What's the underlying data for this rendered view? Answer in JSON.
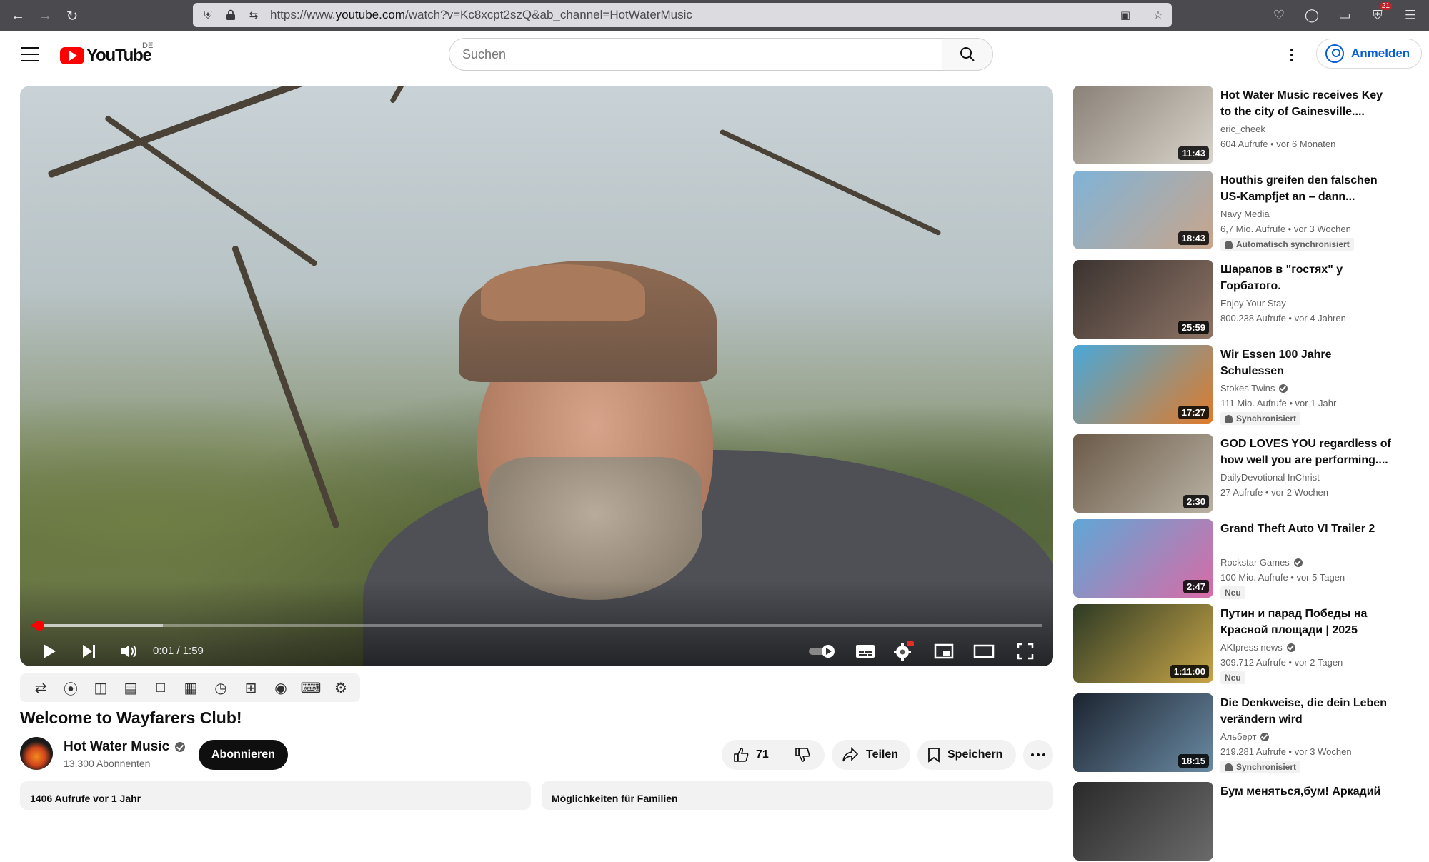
{
  "browser": {
    "url_prefix": "https://www.",
    "url_domain": "youtube.com",
    "url_path": "/watch?v=Kc8xcpt2szQ&ab_channel=HotWaterMusic",
    "extension_badge": "21"
  },
  "header": {
    "logo_text": "YouTube",
    "country": "DE",
    "search_placeholder": "Suchen",
    "signin_label": "Anmelden"
  },
  "player": {
    "time": "0:01 / 1:59",
    "progress": 0.008,
    "buffered": 0.13,
    "colors": {
      "progress": "#ff0000"
    }
  },
  "video": {
    "title": "Welcome to Wayfarers Club!",
    "channel": "Hot Water Music",
    "subscribers": "13.300 Abonnenten",
    "subscribe_label": "Abonnieren",
    "likes": "71",
    "share_label": "Teilen",
    "save_label": "Speichern",
    "views_date": "1406 Aufrufe  vor 1 Jahr",
    "family_text": "Möglichkeiten für Familien"
  },
  "recommendations": [
    {
      "title": "Hot Water Music receives Key to the city of Gainesville....",
      "channel": "eric_cheek",
      "verified": false,
      "meta": "604 Aufrufe  • vor 6 Monaten",
      "duration": "11:43",
      "badge": "",
      "thumb": [
        "#8a8177",
        "#d9d4cc"
      ]
    },
    {
      "title": "Houthis greifen den falschen US-Kampfjet an – dann...",
      "channel": "Navy Media",
      "verified": false,
      "meta": "6,7 Mio. Aufrufe  • vor 3 Wochen",
      "duration": "18:43",
      "badge": "Automatisch synchronisiert",
      "thumb": [
        "#7fb3d8",
        "#c9a58a"
      ]
    },
    {
      "title": "Шарапов в \"гостях\" у Горбатого.",
      "channel": "Enjoy Your Stay",
      "verified": false,
      "meta": "800.238 Aufrufe  • vor 4 Jahren",
      "duration": "25:59",
      "badge": "",
      "thumb": [
        "#3b3330",
        "#8e7466"
      ]
    },
    {
      "title": "Wir Essen 100 Jahre Schulessen",
      "channel": "Stokes Twins",
      "verified": true,
      "meta": "111 Mio. Aufrufe  • vor 1 Jahr",
      "duration": "17:27",
      "badge": "Synchronisiert",
      "thumb": [
        "#4aa8d8",
        "#e07b2b"
      ]
    },
    {
      "title": "GOD LOVES YOU regardless of how well you are performing....",
      "channel": "DailyDevotional InChrist",
      "verified": false,
      "meta": "27 Aufrufe  • vor 2 Wochen",
      "duration": "2:30",
      "badge": "",
      "thumb": [
        "#6b5a48",
        "#b9b2a4"
      ]
    },
    {
      "title": "Grand Theft Auto VI Trailer 2",
      "channel": "Rockstar Games",
      "verified": true,
      "meta": "100 Mio. Aufrufe  • vor 5 Tagen",
      "duration": "2:47",
      "badge": "Neu",
      "thumb": [
        "#5fa7d6",
        "#d96ba6"
      ]
    },
    {
      "title": "Путин и парад Победы на Красной площади | 2025",
      "channel": "AKIpress news",
      "verified": true,
      "meta": "309.712 Aufrufe  • vor 2 Tagen",
      "duration": "1:11:00",
      "badge": "Neu",
      "thumb": [
        "#2d3a24",
        "#c8a548"
      ]
    },
    {
      "title": "Die Denkweise, die dein Leben verändern wird",
      "channel": "Альберт",
      "verified": true,
      "meta": "219.281 Aufrufe  • vor 3 Wochen",
      "duration": "18:15",
      "badge": "Synchronisiert",
      "thumb": [
        "#1c2430",
        "#6a8aa3"
      ]
    },
    {
      "title": "Бум меняться,бум! Аркадий",
      "channel": "",
      "verified": false,
      "meta": "",
      "duration": "",
      "badge": "",
      "thumb": [
        "#2a2a2a",
        "#6a6a6a"
      ]
    }
  ]
}
